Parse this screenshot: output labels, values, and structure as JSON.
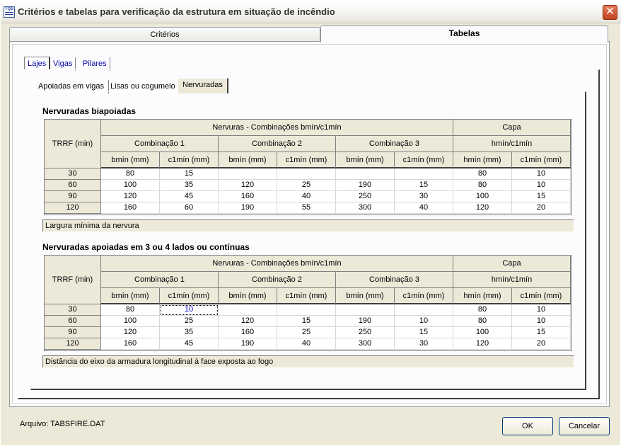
{
  "window": {
    "title": "Critérios e tabelas para verificação da estrutura em situação de incêndio",
    "app_icon_label": "TQS"
  },
  "outer_tabs": [
    {
      "label": "Critérios"
    },
    {
      "label": "Tabelas"
    }
  ],
  "middle_tabs": [
    {
      "label": "Lajes"
    },
    {
      "label": "Vigas"
    },
    {
      "label": "Pilares"
    }
  ],
  "inner_tabs": [
    {
      "label": "Apoiadas em vigas"
    },
    {
      "label": "Lisas ou cogumelo"
    },
    {
      "label": "Nervuradas"
    }
  ],
  "headers": {
    "trrf": "TRRF (min)",
    "nervuras": "Nervuras - Combinações bmín/c1mín",
    "capa": "Capa",
    "comb1": "Combinação 1",
    "comb2": "Combinação 2",
    "comb3": "Combinação 3",
    "capa_sub": "hmín/c1mín",
    "bmin": "bmín (mm)",
    "c1min": "c1mín (mm)",
    "hmin": "hmín (mm)"
  },
  "table1": {
    "title": "Nervuradas biapoiadas",
    "rows": [
      {
        "trrf": "30",
        "cells": [
          "80",
          "15",
          "",
          "",
          "",
          "",
          "80",
          "10"
        ]
      },
      {
        "trrf": "60",
        "cells": [
          "100",
          "35",
          "120",
          "25",
          "190",
          "15",
          "80",
          "10"
        ]
      },
      {
        "trrf": "90",
        "cells": [
          "120",
          "45",
          "160",
          "40",
          "250",
          "30",
          "100",
          "15"
        ]
      },
      {
        "trrf": "120",
        "cells": [
          "160",
          "60",
          "190",
          "55",
          "300",
          "40",
          "120",
          "20"
        ]
      }
    ],
    "status": "Largura mínima da nervura"
  },
  "table2": {
    "title": "Nervuradas apoiadas em 3 ou 4 lados ou contínuas",
    "rows": [
      {
        "trrf": "30",
        "cells": [
          "80",
          "10",
          "",
          "",
          "",
          "",
          "80",
          "10"
        ]
      },
      {
        "trrf": "60",
        "cells": [
          "100",
          "25",
          "120",
          "15",
          "190",
          "10",
          "80",
          "10"
        ]
      },
      {
        "trrf": "90",
        "cells": [
          "120",
          "35",
          "160",
          "25",
          "250",
          "15",
          "100",
          "15"
        ]
      },
      {
        "trrf": "120",
        "cells": [
          "160",
          "45",
          "190",
          "40",
          "300",
          "30",
          "120",
          "20"
        ]
      }
    ],
    "status": "Distância do eixo da armadura longitudinal à face exposta ao fogo"
  },
  "footer": {
    "file_label": "Arquivo: TABSFIRE.DAT",
    "ok_label": "OK",
    "cancel_label": "Cancelar"
  }
}
